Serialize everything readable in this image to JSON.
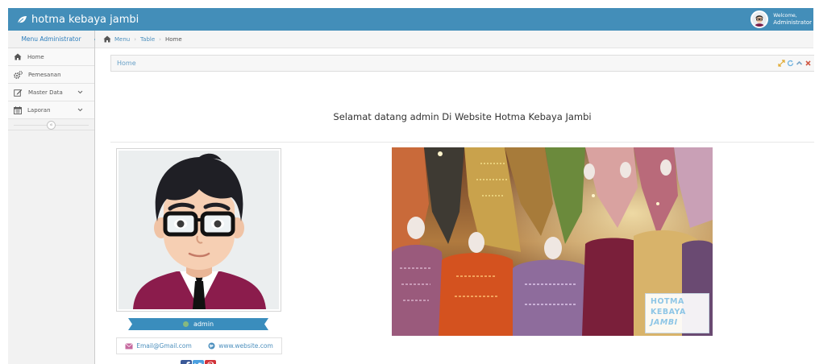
{
  "navbar": {
    "brand": "hotma kebaya jambi",
    "welcome": "Welcome,",
    "user_role": "Administrator"
  },
  "sidebar": {
    "header": "Menu Administrator",
    "items": [
      {
        "label": "Home",
        "icon": "home-icon"
      },
      {
        "label": "Pemesanan",
        "icon": "cogs-icon"
      },
      {
        "label": "Master Data",
        "icon": "edit-icon",
        "has_submenu": true
      },
      {
        "label": "Laporan",
        "icon": "calendar-icon",
        "has_submenu": true
      }
    ],
    "collapse_glyph": "«"
  },
  "breadcrumb": {
    "items": [
      "Menu",
      "Table",
      "Home"
    ]
  },
  "widget": {
    "title": "Home",
    "toolbar_icons": [
      "expand-icon",
      "refresh-icon",
      "collapse-icon",
      "close-icon"
    ]
  },
  "main": {
    "welcome_text": "Selamat datang admin Di Website Hotma Kebaya Jambi",
    "profile": {
      "username": "admin",
      "email": "Email@Gmail.com",
      "website": "www.website.com",
      "status_color": "#87b87f"
    },
    "logo_lines": [
      "HOTMA",
      "KEBAYA",
      "JAMBI"
    ]
  },
  "colors": {
    "navbar": "#438eb9",
    "link": "#4c8fbd",
    "ribbon": "#3a8dbd"
  }
}
